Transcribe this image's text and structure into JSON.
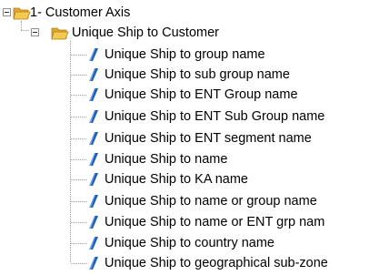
{
  "tree": {
    "root": {
      "label": "1- Customer Axis",
      "expanded": true,
      "icon": "open-folder-icon"
    },
    "group": {
      "label": "Unique Ship to Customer",
      "expanded": true,
      "icon": "open-folder-icon",
      "items": [
        {
          "label": "Unique Ship to group name",
          "icon": "dimension-pin-icon"
        },
        {
          "label": "Unique Ship to sub group name",
          "icon": "dimension-pin-icon"
        },
        {
          "label": "Unique Ship to ENT Group name",
          "icon": "dimension-pin-icon"
        },
        {
          "label": "Unique Ship to ENT Sub Group name",
          "icon": "dimension-pin-icon"
        },
        {
          "label": "Unique Ship to ENT segment name",
          "icon": "dimension-pin-icon"
        },
        {
          "label": "Unique Ship to name",
          "icon": "dimension-pin-icon"
        },
        {
          "label": "Unique Ship to KA name",
          "icon": "dimension-pin-icon"
        },
        {
          "label": "Unique Ship to name or group name",
          "icon": "dimension-pin-icon"
        },
        {
          "label": "Unique Ship to name or ENT grp nam",
          "icon": "dimension-pin-icon"
        },
        {
          "label": "Unique Ship to country name",
          "icon": "dimension-pin-icon"
        },
        {
          "label": "Unique Ship to geographical sub-zone",
          "icon": "dimension-pin-icon"
        }
      ]
    }
  },
  "colors": {
    "folder_front": "#f3c94f",
    "folder_back": "#e0a82a",
    "folder_border": "#b07d18",
    "pin_light": "#6fa3e8",
    "pin_dark": "#1f5fb8",
    "connector": "#9a9a9a"
  }
}
